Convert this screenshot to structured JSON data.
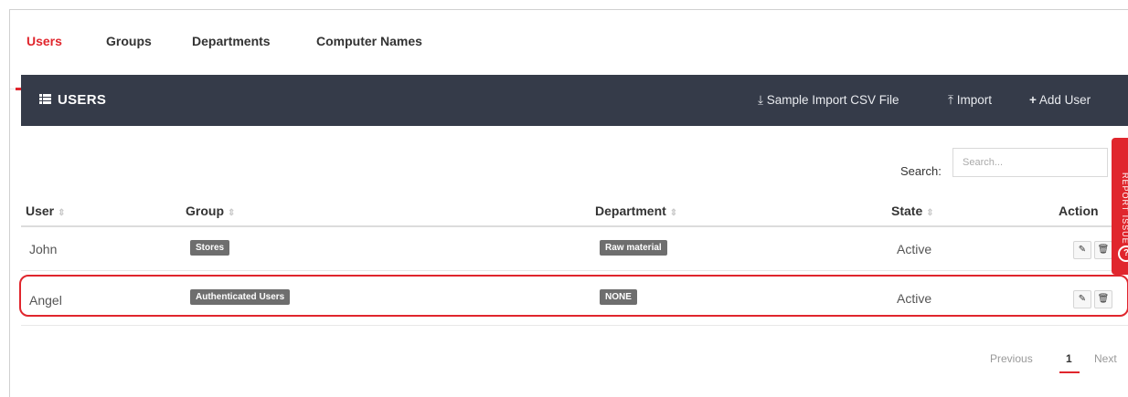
{
  "tabs": [
    {
      "label": "Users",
      "active": true
    },
    {
      "label": "Groups"
    },
    {
      "label": "Departments"
    },
    {
      "label": "Computer Names"
    }
  ],
  "panel": {
    "title": "USERS",
    "actions": {
      "sample": "Sample Import CSV File",
      "import": "Import",
      "add": "Add User"
    }
  },
  "search": {
    "label": "Search:",
    "placeholder": "Search..."
  },
  "table": {
    "headers": [
      "User",
      "Group",
      "Department",
      "State",
      "Action"
    ],
    "rows": [
      {
        "user": "John",
        "group": "Stores",
        "department": "Raw material",
        "state": "Active"
      },
      {
        "user": "Angel",
        "group": "Authenticated Users",
        "department": "NONE",
        "state": "Active"
      }
    ]
  },
  "pagination": {
    "previous": "Previous",
    "page": "1",
    "next": "Next"
  },
  "side_tab": {
    "label": "REPORT ISSUE"
  },
  "colors": {
    "accent": "#e0262d",
    "header_bg": "#353b49",
    "badge_bg": "#6e6e6e"
  },
  "icons": [
    "list-icon",
    "download-icon",
    "upload-icon",
    "plus-icon",
    "sort-icon",
    "edit-icon",
    "delete-icon",
    "help-icon"
  ]
}
